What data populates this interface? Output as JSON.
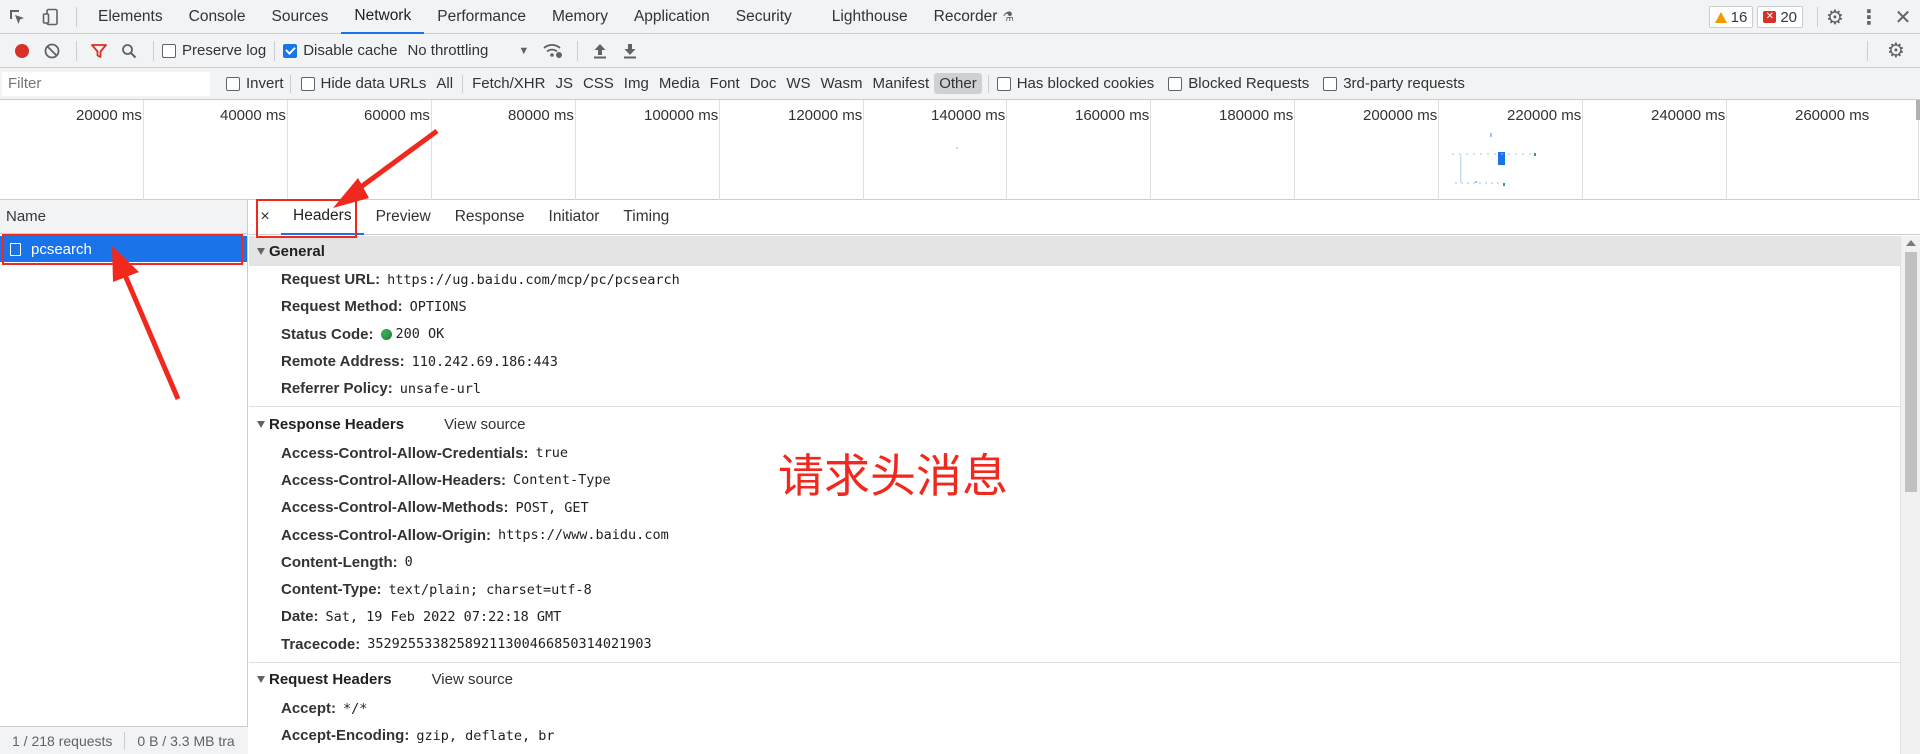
{
  "devtools": {
    "tabs": [
      "Elements",
      "Console",
      "Sources",
      "Network",
      "Performance",
      "Memory",
      "Application",
      "Security",
      "Lighthouse",
      "Recorder"
    ],
    "active_tab": "Network",
    "warnings_count": "16",
    "errors_count": "20"
  },
  "toolbar": {
    "preserve_log": "Preserve log",
    "disable_cache": "Disable cache",
    "throttling": "No throttling"
  },
  "filterbar": {
    "placeholder": "Filter",
    "invert": "Invert",
    "hide_data_urls": "Hide data URLs",
    "types": [
      "All",
      "Fetch/XHR",
      "JS",
      "CSS",
      "Img",
      "Media",
      "Font",
      "Doc",
      "WS",
      "Wasm",
      "Manifest",
      "Other"
    ],
    "selected_type": "Other",
    "has_blocked_cookies": "Has blocked cookies",
    "blocked_requests": "Blocked Requests",
    "third_party": "3rd-party requests"
  },
  "overview": {
    "ticks": [
      "20000 ms",
      "40000 ms",
      "60000 ms",
      "80000 ms",
      "100000 ms",
      "120000 ms",
      "140000 ms",
      "160000 ms",
      "180000 ms",
      "200000 ms",
      "220000 ms",
      "240000 ms",
      "260000 ms"
    ]
  },
  "request_list": {
    "header": "Name",
    "items": [
      "pcsearch"
    ],
    "status_requests": "1 / 218 requests",
    "status_size": "0 B / 3.3 MB tra"
  },
  "detail": {
    "close": "×",
    "tabs": [
      "Headers",
      "Preview",
      "Response",
      "Initiator",
      "Timing"
    ],
    "active_tab": "Headers",
    "view_source": "View source",
    "general": {
      "title": "General",
      "rows": [
        {
          "name": "Request URL:",
          "value": "https://ug.baidu.com/mcp/pc/pcsearch"
        },
        {
          "name": "Request Method:",
          "value": "OPTIONS"
        },
        {
          "name": "Status Code:",
          "value": "200 OK"
        },
        {
          "name": "Remote Address:",
          "value": "110.242.69.186:443"
        },
        {
          "name": "Referrer Policy:",
          "value": "unsafe-url"
        }
      ]
    },
    "response_headers": {
      "title": "Response Headers",
      "rows": [
        {
          "name": "Access-Control-Allow-Credentials:",
          "value": "true"
        },
        {
          "name": "Access-Control-Allow-Headers:",
          "value": "Content-Type"
        },
        {
          "name": "Access-Control-Allow-Methods:",
          "value": "POST, GET"
        },
        {
          "name": "Access-Control-Allow-Origin:",
          "value": "https://www.baidu.com"
        },
        {
          "name": "Content-Length:",
          "value": "0"
        },
        {
          "name": "Content-Type:",
          "value": "text/plain; charset=utf-8"
        },
        {
          "name": "Date:",
          "value": "Sat, 19 Feb 2022 07:22:18 GMT"
        },
        {
          "name": "Tracecode:",
          "value": "35292553382589211300466850314021903"
        }
      ]
    },
    "request_headers": {
      "title": "Request Headers",
      "rows": [
        {
          "name": "Accept:",
          "value": "*/*"
        },
        {
          "name": "Accept-Encoding:",
          "value": "gzip, deflate, br"
        }
      ]
    }
  },
  "annotation": {
    "text": "请求头消息",
    "color": "#f0281e"
  }
}
